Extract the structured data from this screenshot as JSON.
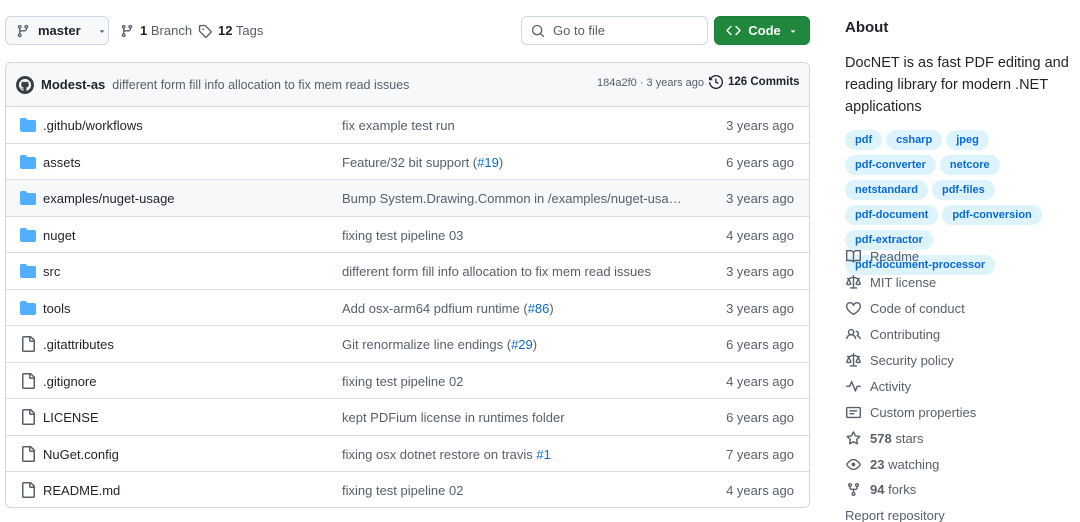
{
  "branch": {
    "name": "master"
  },
  "branches": {
    "count": "1",
    "label": "Branch"
  },
  "tags": {
    "count": "12",
    "label": "Tags"
  },
  "search": {
    "placeholder": "Go to file"
  },
  "code_button": {
    "label": "Code"
  },
  "latest_commit": {
    "author": "Modest-as",
    "message": "different form fill info allocation to fix mem read issues",
    "hash": "184a2f0",
    "age": "3 years ago",
    "hash_age": "184a2f0 · 3 years ago",
    "commits_label": "126 Commits"
  },
  "files": [
    {
      "type": "dir",
      "name": ".github/workflows",
      "message": "fix example test run",
      "ref": "",
      "date": "3 years ago"
    },
    {
      "type": "dir",
      "name": "assets",
      "message": "Feature/32 bit support (",
      "ref": "#19",
      "suffix": ")",
      "date": "6 years ago"
    },
    {
      "type": "dir",
      "name": "examples/nuget-usage",
      "message": "Bump System.Drawing.Common in /examples/nuget-usage/…",
      "ref": "",
      "date": "3 years ago"
    },
    {
      "type": "dir",
      "name": "nuget",
      "message": "fixing test pipeline 03",
      "ref": "",
      "date": "4 years ago"
    },
    {
      "type": "dir",
      "name": "src",
      "message": "different form fill info allocation to fix mem read issues",
      "ref": "",
      "date": "3 years ago"
    },
    {
      "type": "dir",
      "name": "tools",
      "message": "Add osx-arm64 pdfium runtime (",
      "ref": "#86",
      "suffix": ")",
      "date": "3 years ago"
    },
    {
      "type": "file",
      "name": ".gitattributes",
      "message": "Git renormalize line endings (",
      "ref": "#29",
      "suffix": ")",
      "date": "6 years ago"
    },
    {
      "type": "file",
      "name": ".gitignore",
      "message": "fixing test pipeline 02",
      "ref": "",
      "date": "4 years ago"
    },
    {
      "type": "file",
      "name": "LICENSE",
      "message": "kept PDFium license in runtimes folder",
      "ref": "",
      "date": "6 years ago"
    },
    {
      "type": "file",
      "name": "NuGet.config",
      "message": "fixing osx dotnet restore on travis ",
      "ref": "#1",
      "date": "7 years ago"
    },
    {
      "type": "file",
      "name": "README.md",
      "message": "fixing test pipeline 02",
      "ref": "",
      "date": "4 years ago"
    }
  ],
  "about": {
    "title": "About",
    "description": "DocNET is as fast PDF editing and reading library for modern .NET applications",
    "topics": [
      "pdf",
      "csharp",
      "jpeg",
      "pdf-converter",
      "netcore",
      "netstandard",
      "pdf-files",
      "pdf-document",
      "pdf-conversion",
      "pdf-extractor",
      "pdf-document-processor"
    ],
    "links": [
      {
        "icon": "book-icon",
        "label": "Readme"
      },
      {
        "icon": "scale-icon",
        "label": "MIT license"
      },
      {
        "icon": "heart-icon",
        "label": "Code of conduct"
      },
      {
        "icon": "people-icon",
        "label": "Contributing"
      },
      {
        "icon": "scale-icon",
        "label": "Security policy"
      },
      {
        "icon": "pulse-icon",
        "label": "Activity"
      },
      {
        "icon": "note-icon",
        "label": "Custom properties"
      },
      {
        "icon": "star-icon",
        "count": "578",
        "label": "stars"
      },
      {
        "icon": "eye-icon",
        "count": "23",
        "label": "watching"
      },
      {
        "icon": "fork-icon",
        "count": "94",
        "label": "forks"
      },
      {
        "icon": "",
        "label": "Report repository"
      }
    ]
  },
  "colors": {
    "accent": "#0969da",
    "code_green": "#1f883d",
    "folder_blue": "#54aeff",
    "topic_bg": "#ddf4ff"
  }
}
